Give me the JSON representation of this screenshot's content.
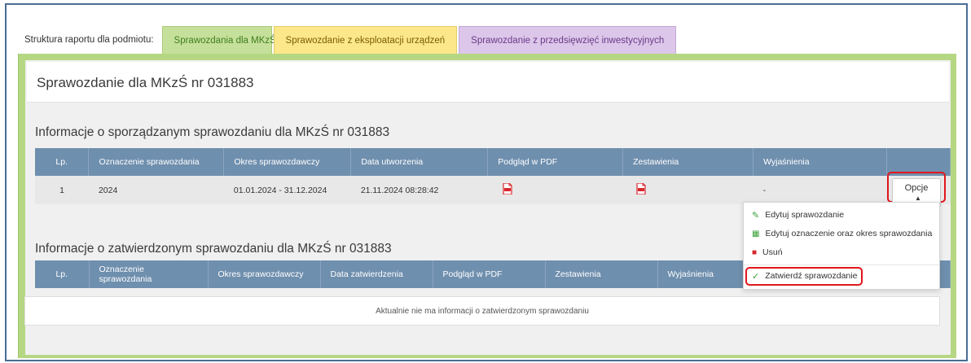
{
  "tabs": {
    "label": "Struktura raportu dla podmiotu:",
    "items": [
      {
        "label": "Sprawozdania dla MKzŚ"
      },
      {
        "label": "Sprawozdanie z eksploatacji urządzeń"
      },
      {
        "label": "Sprawozdanie z przedsięwzięć inwestycyjnych"
      }
    ]
  },
  "page_title": "Sprawozdanie dla MKzŚ nr 031883",
  "section1": {
    "heading": "Informacje o sporządzanym sprawozdaniu dla MKzŚ nr 031883",
    "columns": [
      "Lp.",
      "Oznaczenie sprawozdania",
      "Okres sprawozdawczy",
      "Data utworzenia",
      "Podgląd w PDF",
      "Zestawienia",
      "Wyjaśnienia",
      ""
    ],
    "row": {
      "lp": "1",
      "oznaczenie": "2024",
      "okres": "01.01.2024 - 31.12.2024",
      "data": "21.11.2024 08:28:42",
      "wyjasnienia": "-",
      "options_label": "Opcje"
    }
  },
  "dropdown": {
    "items": [
      {
        "label": "Edytuj sprawozdanie",
        "icon": "edit-icon"
      },
      {
        "label": "Edytuj oznaczenie oraz okres sprawozdania",
        "icon": "calendar-icon"
      },
      {
        "label": "Usuń",
        "icon": "trash-icon"
      },
      {
        "label": "Zatwierdź sprawozdanie",
        "icon": "check-icon"
      }
    ]
  },
  "section2": {
    "heading": "Informacje o zatwierdzonym sprawozdaniu dla MKzŚ nr 031883",
    "columns": [
      "Lp.",
      "Oznaczenie sprawozdania",
      "Okres sprawozdawczy",
      "Data zatwierdzenia",
      "Podgląd w PDF",
      "Zestawienia",
      "Wyjaśnienia",
      ""
    ],
    "empty_message": "Aktualnie nie ma informacji o zatwierdzonym sprawozdaniu"
  },
  "colors": {
    "header_blue": "#6f8fae",
    "highlight_red": "#e0161c",
    "pdf_red": "#d9262c",
    "green_tab": "#c5e09a"
  }
}
